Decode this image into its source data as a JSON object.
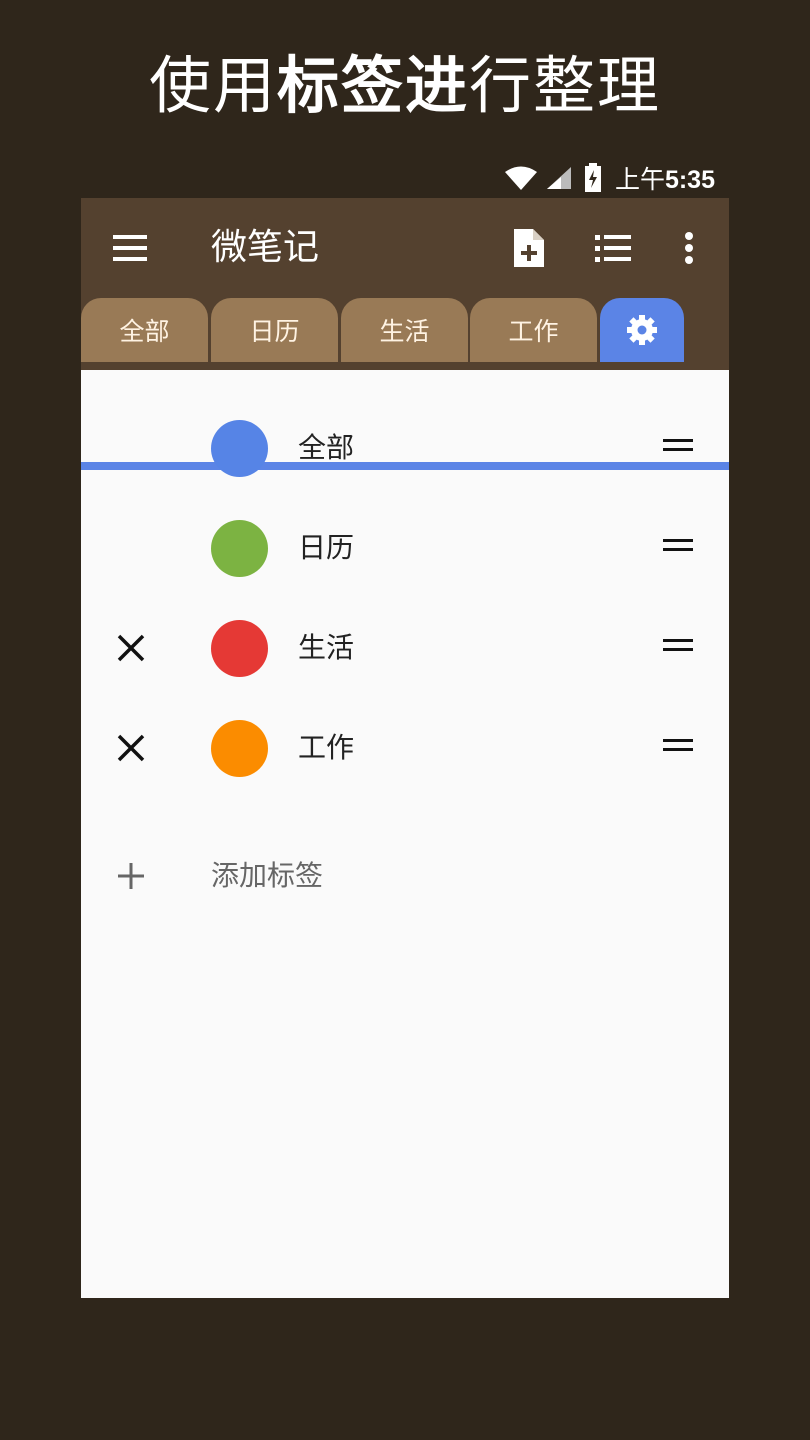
{
  "headline": {
    "part1": "使用",
    "bold": "标签进",
    "part2": "行整理"
  },
  "status_bar": {
    "period": "上午",
    "time": "5:35"
  },
  "app": {
    "title": "微笔记"
  },
  "toolbar": {
    "menu_icon": "hamburger-menu-icon",
    "new_note_icon": "note-add-icon",
    "list_icon": "list-view-icon",
    "more_icon": "more-vert-icon"
  },
  "tabs": [
    {
      "label": "全部"
    },
    {
      "label": "日历"
    },
    {
      "label": "生活"
    },
    {
      "label": "工作"
    },
    {
      "icon": "settings-gear-icon",
      "active": true
    }
  ],
  "tags": [
    {
      "label": "全部",
      "color": "#5684e6",
      "deletable": false
    },
    {
      "label": "日历",
      "color": "#7cb342",
      "deletable": false
    },
    {
      "label": "生活",
      "color": "#e53935",
      "deletable": true
    },
    {
      "label": "工作",
      "color": "#fb8c00",
      "deletable": true
    }
  ],
  "add_tag": {
    "label": "添加标签"
  },
  "colors": {
    "background": "#2f261b",
    "appbar": "#54412f",
    "tab": "#997a56",
    "accent": "#5b84e6"
  }
}
